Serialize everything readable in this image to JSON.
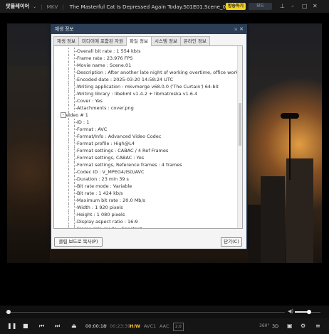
{
  "titlebar": {
    "app_name": "팟플레이어",
    "format": "MKV",
    "filename": "The Masterful Cat Is Depressed Again Today.S01E01.Scene_01.mkv",
    "badge": "방송하기",
    "mode": "모드"
  },
  "dialog": {
    "title": "재생 정보",
    "tabs": [
      "재생 정보",
      "미디어에 포함된 자원",
      "파일 정보",
      "시스템 정보",
      "온라인 정보"
    ],
    "active_tab": 2,
    "rows": [
      {
        "text": "Overall bit rate : 1 554 kb/s",
        "level": 2
      },
      {
        "text": "Frame rate : 23.976 FPS",
        "level": 2
      },
      {
        "text": "Movie name : Scene.01",
        "level": 2
      },
      {
        "text": "Description : After another late night of working overtime, office worker Saki returns h",
        "level": 2
      },
      {
        "text": "Encoded date : 2025-03-20 14:58:24 UTC",
        "level": 2
      },
      {
        "text": "Writing application : mkvmerge v68.0.0 ('The Curtain') 64-bit",
        "level": 2
      },
      {
        "text": "Writing library : libebml v1.4.2 + libmatroska v1.6.4",
        "level": 2
      },
      {
        "text": "Cover : Yes",
        "level": 2
      },
      {
        "text": "Attachments : cover.png",
        "level": 2
      },
      {
        "text": "Video # 1",
        "level": 1,
        "expander": "-"
      },
      {
        "text": "ID : 1",
        "level": 2
      },
      {
        "text": "Format : AVC",
        "level": 2
      },
      {
        "text": "Format/Info : Advanced Video Codec",
        "level": 2
      },
      {
        "text": "Format profile : High@L4",
        "level": 2
      },
      {
        "text": "Format settings : CABAC / 4 Ref Frames",
        "level": 2
      },
      {
        "text": "Format settings, CABAC : Yes",
        "level": 2
      },
      {
        "text": "Format settings, Reference frames : 4 frames",
        "level": 2
      },
      {
        "text": "Codec ID : V_MPEG4/ISO/AVC",
        "level": 2
      },
      {
        "text": "Duration : 23 min 39 s",
        "level": 2
      },
      {
        "text": "Bit rate mode : Variable",
        "level": 2
      },
      {
        "text": "Bit rate : 1 424 kb/s",
        "level": 2
      },
      {
        "text": "Maximum bit rate : 20.0 Mb/s",
        "level": 2
      },
      {
        "text": "Width : 1 920 pixels",
        "level": 2
      },
      {
        "text": "Height : 1 080 pixels",
        "level": 2
      },
      {
        "text": "Display aspect ratio : 16:9",
        "level": 2
      },
      {
        "text": "Frame rate mode : Constant",
        "level": 2
      }
    ],
    "copy_button": "클립 보드로 복사(P)",
    "close_button": "닫기(C)"
  },
  "player": {
    "time_current": "00:00:18",
    "time_sep": "/",
    "time_total": "00:23:39",
    "hw": "H/W",
    "video_codec": "AVC1",
    "audio_codec": "AAC",
    "channels": "2.0",
    "label_3d": "3D",
    "label_360": "360°",
    "seek_progress": 0.01,
    "volume": 0.55
  },
  "icons": {
    "pause": "pause-icon",
    "stop": "stop-icon",
    "prev": "previous-icon",
    "next": "next-icon",
    "eject": "eject-icon",
    "volume": "volume-icon",
    "subtitle": "subtitle-icon",
    "settings": "gear-icon",
    "playlist": "menu-icon"
  },
  "colors": {
    "accent": "#f3d21c",
    "dialog_title_bg": "#2c3e56",
    "hw_label": "#f0c23a"
  }
}
